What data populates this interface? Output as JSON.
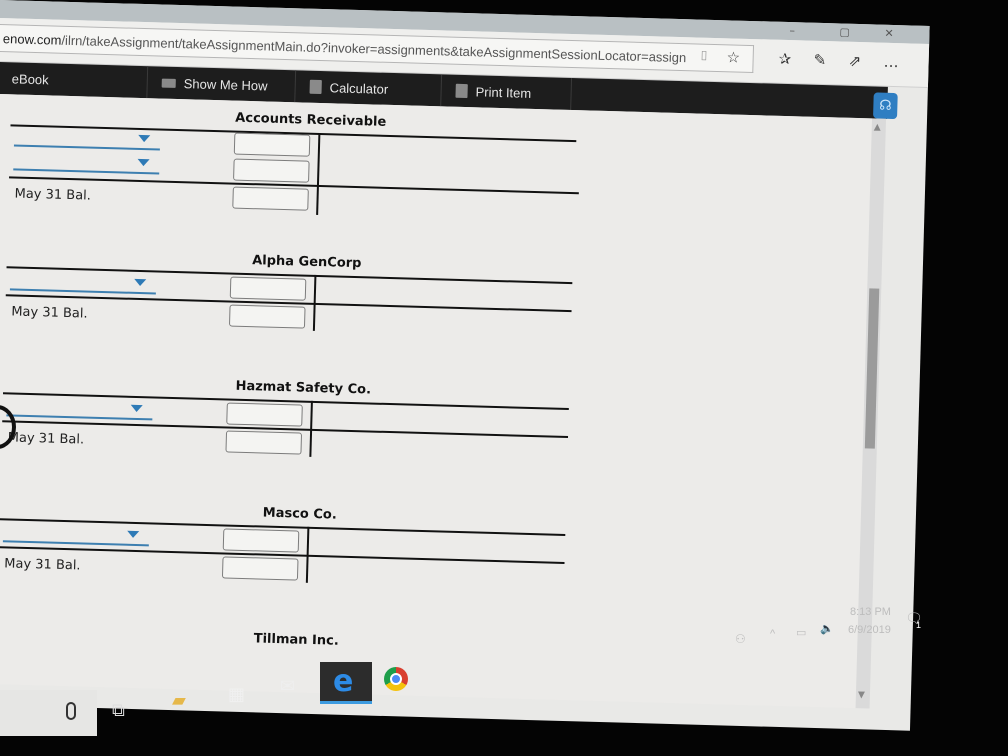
{
  "browser": {
    "url_host": "enow.com",
    "url_path": "/ilrn/takeAssignment/takeAssignmentMain.do?invoker=assignments&takeAssignmentSessionLocator=assign",
    "window_controls": [
      "–",
      "▢",
      "✕"
    ],
    "address_icons": [
      "reading-view",
      "favorite-star",
      "favorites-hub",
      "web-note",
      "share",
      "more"
    ]
  },
  "toolbar": {
    "ebook": "eBook",
    "show_me_how": "Show Me How",
    "calculator": "Calculator",
    "print_item": "Print Item"
  },
  "accounts": [
    {
      "title": "Accounts Receivable",
      "dropdowns": 2,
      "balance_label": "May 31 Bal."
    },
    {
      "title": "Alpha GenCorp",
      "dropdowns": 1,
      "balance_label": "May 31 Bal."
    },
    {
      "title": "Hazmat Safety Co.",
      "dropdowns": 1,
      "balance_label": "May 31 Bal."
    },
    {
      "title": "Masco Co.",
      "dropdowns": 1,
      "balance_label": "May 31 Bal."
    },
    {
      "title": "Tillman Inc."
    }
  ],
  "taskbar": {
    "apps": [
      "cortana-mic",
      "task-view",
      "file-explorer",
      "microsoft-store",
      "mail",
      "edge",
      "chrome"
    ],
    "active_app": "edge",
    "accent": "#3d9be0"
  },
  "tray": {
    "time": "8:13 PM",
    "date": "6/9/2019",
    "notification_count": "1"
  },
  "colors": {
    "toolbar_bg": "#1d1d1d",
    "dropdown_accent": "#2e7ab6",
    "help_button": "#2f7ec2"
  }
}
